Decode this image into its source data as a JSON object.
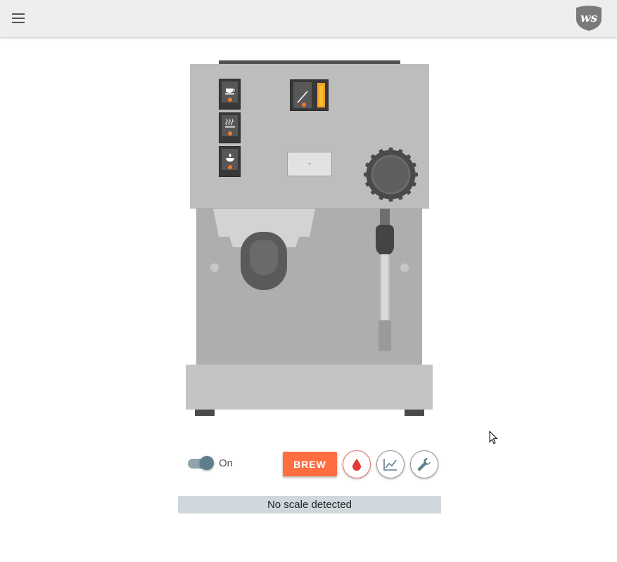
{
  "header": {
    "menu_icon": "hamburger-menu-icon",
    "logo_text": "ws",
    "logo_color": "#7a7a7a"
  },
  "machine": {
    "display_value": "-",
    "switch_icons": [
      "espresso-cup-icon",
      "steam-icon",
      "hot-water-icon"
    ],
    "indicator_lamp_color": "#f5762a",
    "gauge_bar_color": "#f7a12a"
  },
  "controls": {
    "power_label": "On",
    "power_on": true,
    "brew_label": "BREW",
    "brew_color": "#ff6e40",
    "water_icon": "water-drop-icon",
    "chart_icon": "line-chart-icon",
    "settings_icon": "wrench-icon"
  },
  "scale": {
    "status": "No scale detected"
  }
}
